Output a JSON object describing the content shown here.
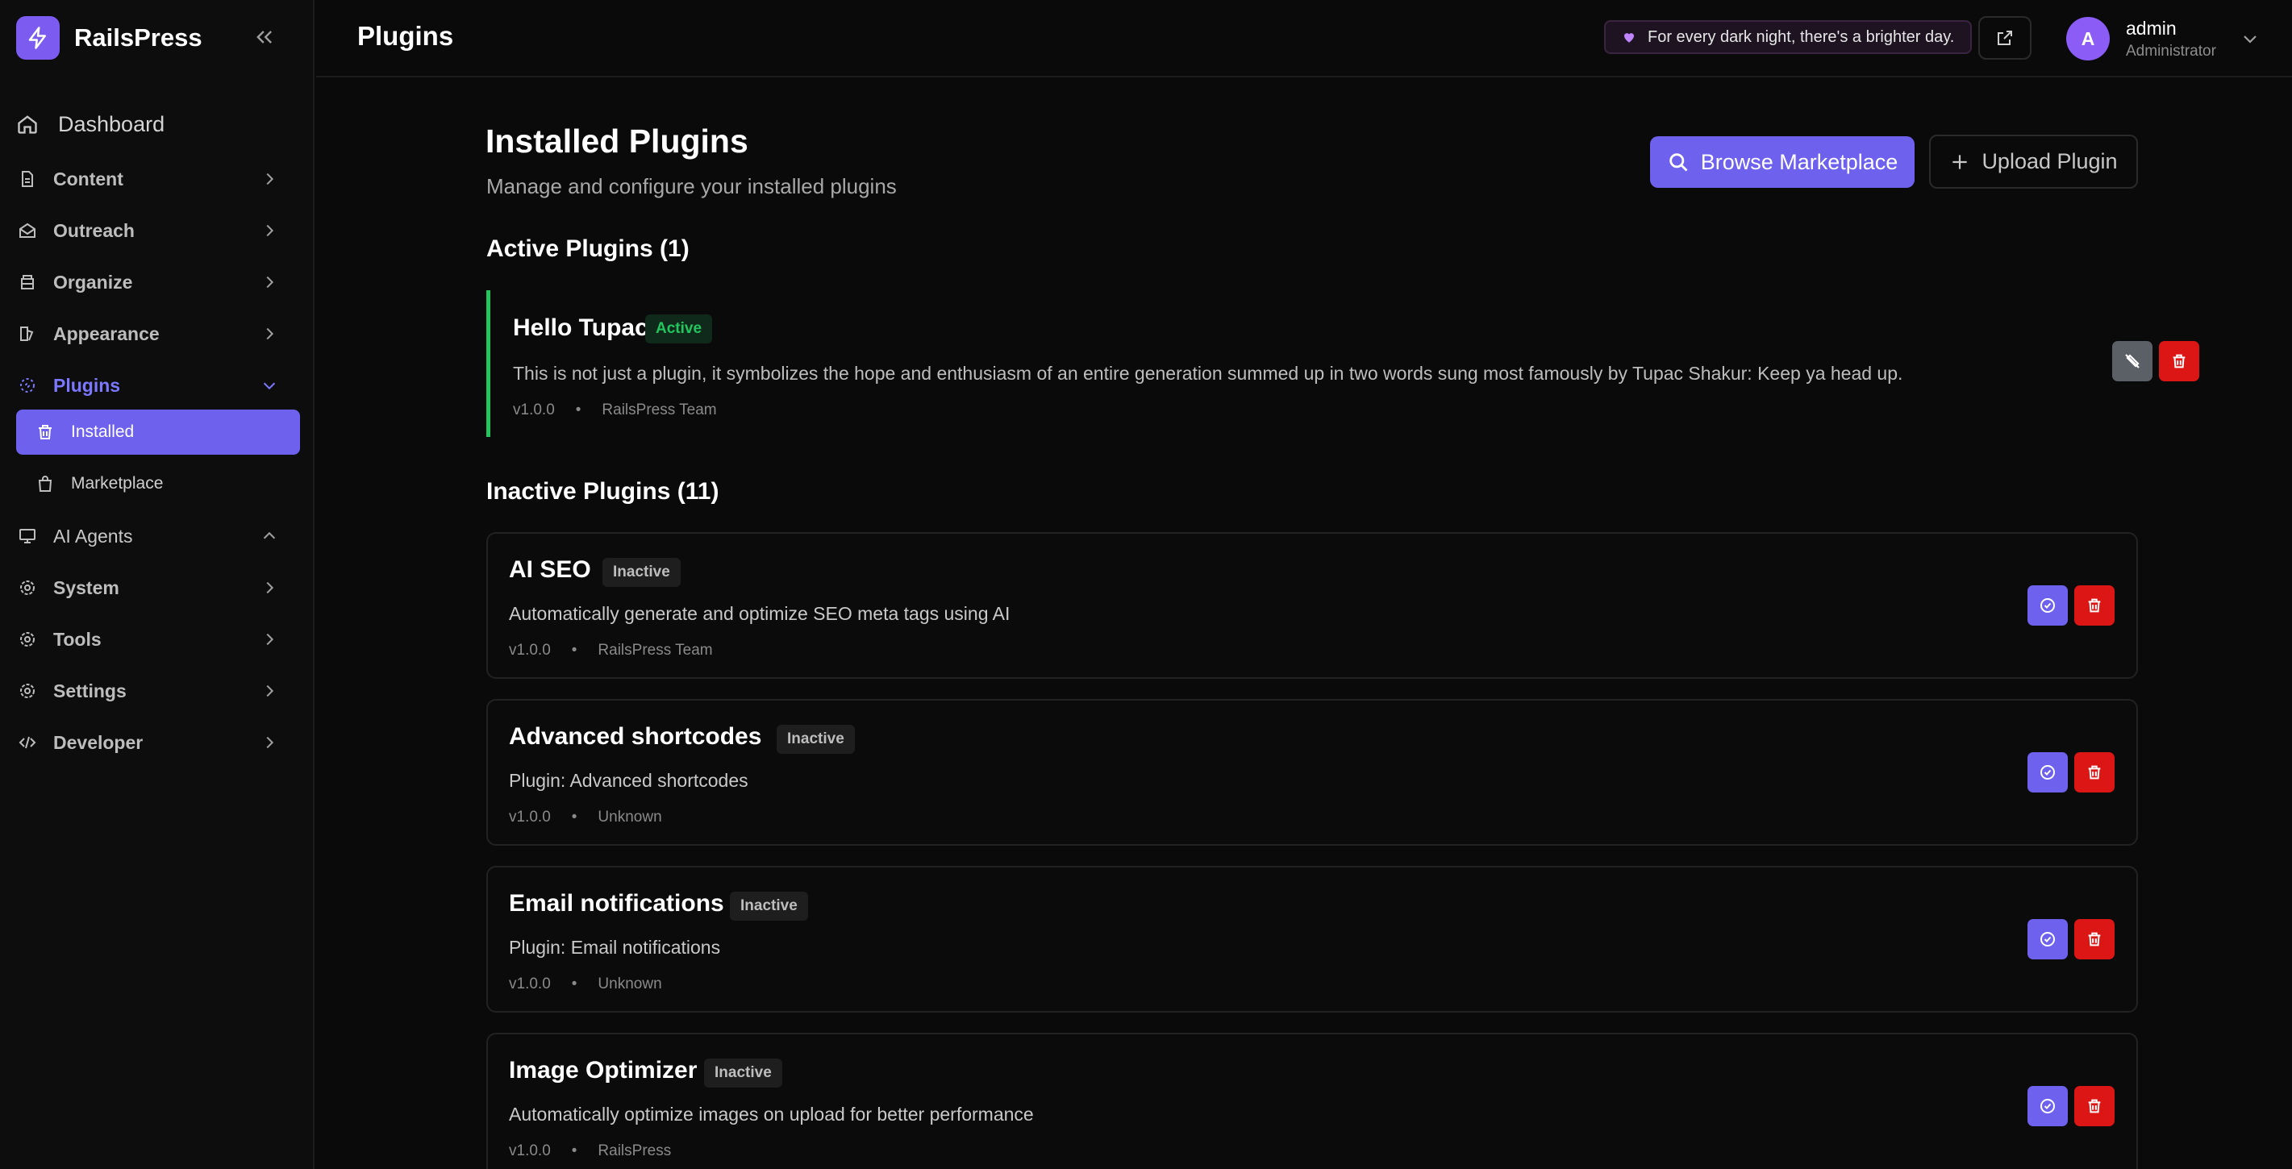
{
  "brand": {
    "name": "RailsPress"
  },
  "sidebar": {
    "items": [
      {
        "label": "Dashboard"
      },
      {
        "label": "Content"
      },
      {
        "label": "Outreach"
      },
      {
        "label": "Organize"
      },
      {
        "label": "Appearance"
      },
      {
        "label": "Plugins"
      },
      {
        "label": "AI Agents"
      },
      {
        "label": "System"
      },
      {
        "label": "Tools"
      },
      {
        "label": "Settings"
      },
      {
        "label": "Developer"
      }
    ],
    "plugins_sub": [
      {
        "label": "Installed",
        "active": true
      },
      {
        "label": "Marketplace",
        "active": false
      }
    ]
  },
  "header": {
    "title": "Plugins",
    "quote": "For every dark night, there's a brighter day.",
    "user": {
      "initial": "A",
      "name": "admin",
      "role": "Administrator"
    }
  },
  "main": {
    "title": "Installed Plugins",
    "subtitle": "Manage and configure your installed plugins",
    "browse_label": "Browse Marketplace",
    "upload_label": "Upload Plugin",
    "active_section": "Active Plugins (1)",
    "inactive_section": "Inactive Plugins (11)",
    "active_plugins": [
      {
        "name": "Hello Tupac!",
        "status": "Active",
        "description": "This is not just a plugin, it symbolizes the hope and enthusiasm of an entire generation summed up in two words sung most famously by Tupac Shakur: Keep ya head up.",
        "version": "v1.0.0",
        "author": "RailsPress Team"
      }
    ],
    "inactive_plugins": [
      {
        "name": "AI SEO",
        "status": "Inactive",
        "description": "Automatically generate and optimize SEO meta tags using AI",
        "version": "v1.0.0",
        "author": "RailsPress Team"
      },
      {
        "name": "Advanced shortcodes",
        "status": "Inactive",
        "description": "Plugin: Advanced shortcodes",
        "version": "v1.0.0",
        "author": "Unknown"
      },
      {
        "name": "Email notifications",
        "status": "Inactive",
        "description": "Plugin: Email notifications",
        "version": "v1.0.0",
        "author": "Unknown"
      },
      {
        "name": "Image Optimizer",
        "status": "Inactive",
        "description": "Automatically optimize images on upload for better performance",
        "version": "v1.0.0",
        "author": "RailsPress"
      }
    ],
    "meta_separator": "•"
  },
  "colors": {
    "accent": "#6e61ee",
    "active_green": "#22c55e",
    "danger": "#dc1515",
    "background": "#0a0a0a"
  },
  "icons": {
    "brand": "bolt-icon",
    "collapse": "double-chevron-left-icon",
    "dashboard": "home-icon",
    "content": "document-icon",
    "outreach": "mail-open-icon",
    "organize": "archive-icon",
    "appearance": "paint-icon",
    "plugins": "plugin-icon",
    "installed": "trash-icon",
    "marketplace": "shopping-bag-icon",
    "ai_agents": "monitor-icon",
    "system": "gear-icon",
    "tools": "gear-icon",
    "settings": "gear-icon",
    "developer": "code-icon",
    "quote": "heart-icon",
    "external": "external-link-icon",
    "deactivate": "plug-off-icon",
    "activate": "check-circle-icon",
    "delete": "trash-icon"
  }
}
